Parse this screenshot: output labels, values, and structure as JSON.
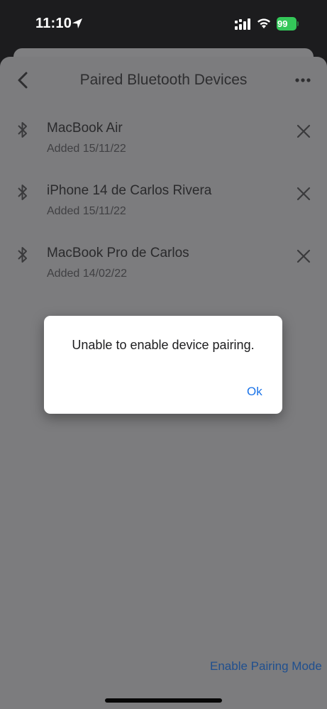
{
  "status_bar": {
    "time": "11:10",
    "battery_percent": "99",
    "icons": [
      "location-arrow-icon",
      "signal-icon",
      "wifi-icon",
      "battery-icon"
    ]
  },
  "header": {
    "title": "Paired Bluetooth Devices",
    "back_icon": "chevron-left-icon",
    "more_icon": "more-horizontal-icon"
  },
  "devices": [
    {
      "name": "MacBook Air",
      "added": "Added 15/11/22"
    },
    {
      "name": "iPhone 14 de Carlos Rivera",
      "added": "Added 15/11/22"
    },
    {
      "name": "MacBook Pro de Carlos",
      "added": "Added 14/02/22"
    }
  ],
  "dialog": {
    "message": "Unable to enable device pairing.",
    "ok_label": "Ok"
  },
  "footer": {
    "enable_pairing_label": "Enable Pairing Mode"
  },
  "colors": {
    "accent": "#1a73e8",
    "battery": "#34c759",
    "overlay_background": "#7c7c7e"
  }
}
